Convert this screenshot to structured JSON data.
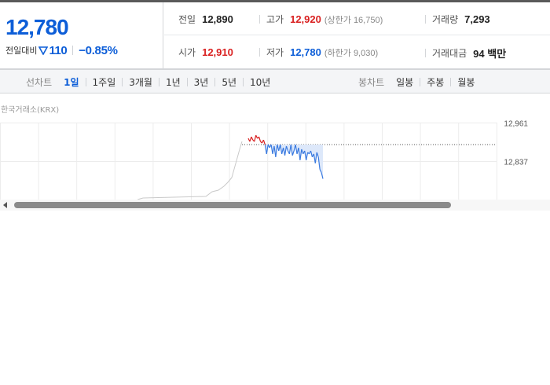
{
  "summary": {
    "current_price": "12,780",
    "change_label": "전일대비",
    "change_direction_icon": "down-triangle-icon",
    "change_amount": "110",
    "change_percent": "−0.85%",
    "prev_close": {
      "label": "전일",
      "value": "12,890"
    },
    "high": {
      "label": "고가",
      "value": "12,920",
      "sub": "(상한가 16,750)"
    },
    "volume": {
      "label": "거래량",
      "value": "7,293"
    },
    "open": {
      "label": "시가",
      "value": "12,910"
    },
    "low": {
      "label": "저가",
      "value": "12,780",
      "sub": "(하한가 9,030)"
    },
    "trade_value": {
      "label": "거래대금",
      "value": "94 백만"
    },
    "colors": {
      "up": "#d91f1f",
      "down": "#0d5ed8"
    }
  },
  "tabs": {
    "line_chart_title": "선차트",
    "line_periods": [
      "1일",
      "1주일",
      "3개월",
      "1년",
      "3년",
      "5년",
      "10년"
    ],
    "active_period": "1일",
    "candle_chart_title": "봉차트",
    "candle_periods": [
      "일봉",
      "주봉",
      "월봉"
    ]
  },
  "chart": {
    "source": "한국거래소(KRX)",
    "y_tick_labels": [
      "12,961",
      "12,837"
    ],
    "reference_price": 12890
  },
  "chart_data": {
    "type": "line",
    "title": "",
    "xlabel": "",
    "ylabel": "",
    "ylim": [
      12713,
      12961
    ],
    "y_ticks": [
      12961,
      12837
    ],
    "x": [
      0,
      1,
      2,
      3,
      4,
      5,
      6,
      7,
      8,
      9,
      10,
      11,
      12,
      13,
      14,
      15,
      16,
      17,
      18,
      19,
      20,
      21,
      22,
      23,
      24,
      25,
      26,
      27,
      28,
      29,
      30,
      31,
      32,
      33,
      34,
      35,
      36,
      37,
      38,
      39,
      40,
      41,
      42,
      43,
      44,
      45,
      46,
      47,
      48,
      49
    ],
    "series": [
      {
        "values": [
          12910,
          12900,
          12915,
          12905,
          12900,
          12920,
          12910,
          12915,
          12900,
          12895,
          12905,
          12890,
          12860,
          12890,
          12880,
          12890,
          12860,
          12885,
          12850,
          12890,
          12870,
          12890,
          12860,
          12880,
          12855,
          12885,
          12870,
          12860,
          12890,
          12855,
          12870,
          12890,
          12860,
          12880,
          12840,
          12875,
          12860,
          12870,
          12840,
          12865,
          12860,
          12870,
          12850,
          12860,
          12830,
          12865,
          12850,
          12810,
          12800,
          12780
        ]
      }
    ],
    "grid": true
  }
}
